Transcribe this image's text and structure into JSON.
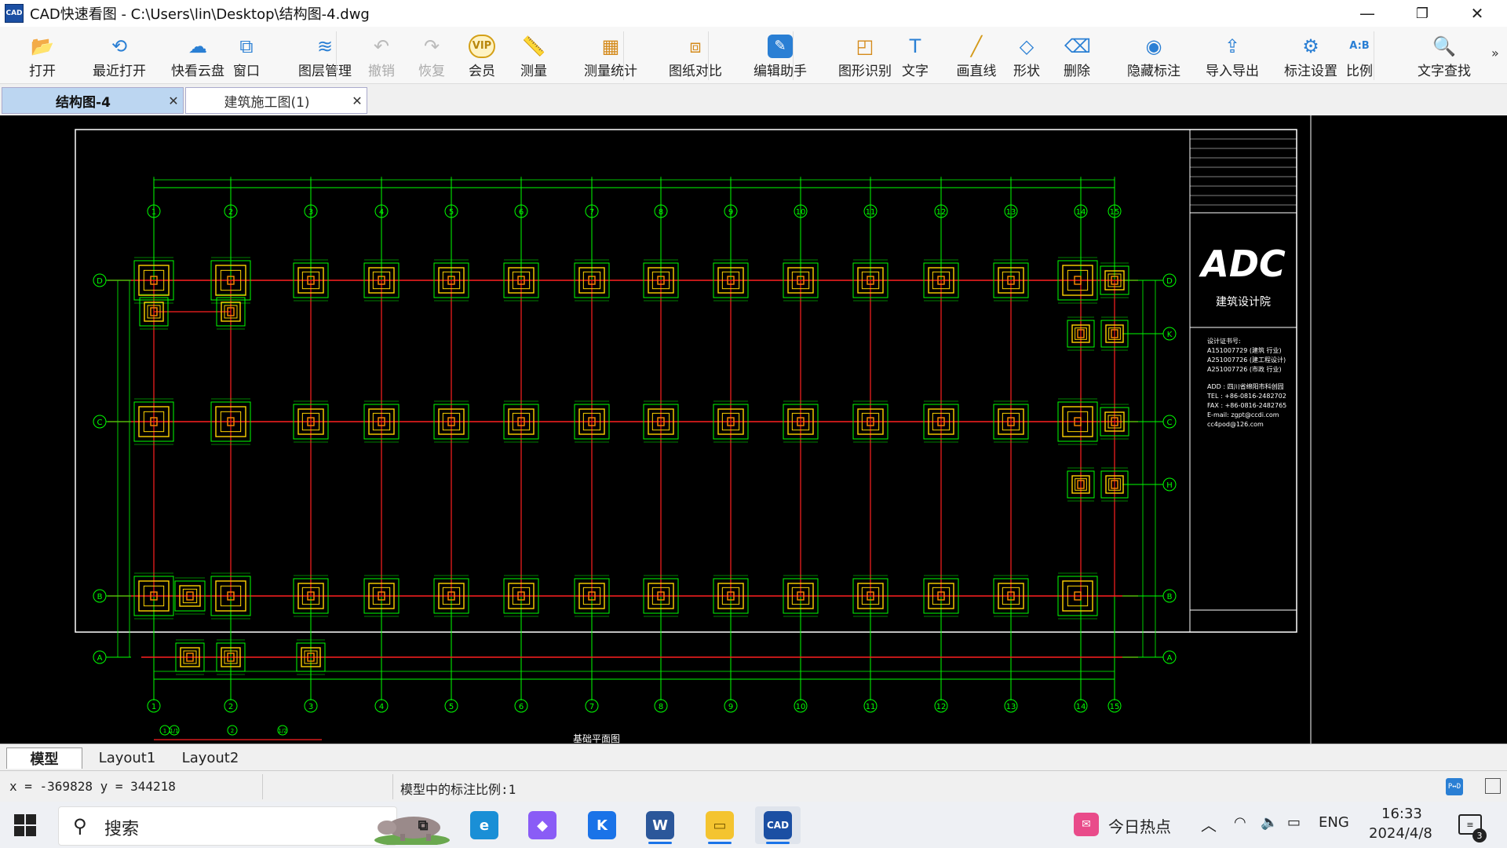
{
  "window": {
    "app_icon_text": "CAD",
    "title": "CAD快速看图 - C:\\Users\\lin\\Desktop\\结构图-4.dwg",
    "minimize": "—",
    "restore": "❐",
    "close": "✕"
  },
  "toolbar": [
    {
      "label": "打开",
      "icon": "folder-open-icon",
      "glyph": "📂",
      "enabled": true
    },
    {
      "label": "最近打开",
      "icon": "history-icon",
      "glyph": "⟲",
      "enabled": true
    },
    {
      "label": "快看云盘",
      "icon": "cloud-icon",
      "glyph": "☁",
      "enabled": true
    },
    {
      "label": "窗口",
      "icon": "window-icon",
      "glyph": "⧉",
      "enabled": true
    },
    {
      "label": "图层管理",
      "icon": "layers-icon",
      "glyph": "≋",
      "enabled": true
    },
    {
      "label": "撤销",
      "icon": "undo-icon",
      "glyph": "↶",
      "enabled": false
    },
    {
      "label": "恢复",
      "icon": "redo-icon",
      "glyph": "↷",
      "enabled": false
    },
    {
      "label": "会员",
      "icon": "vip-icon",
      "glyph": "VIP",
      "enabled": true
    },
    {
      "label": "测量",
      "icon": "ruler-icon",
      "glyph": "📏",
      "enabled": true
    },
    {
      "label": "测量统计",
      "icon": "measure-stats-icon",
      "glyph": "▦",
      "enabled": true
    },
    {
      "label": "图纸对比",
      "icon": "compare-icon",
      "glyph": "⧈",
      "enabled": true
    },
    {
      "label": "编辑助手",
      "icon": "edit-assistant-icon",
      "glyph": "✎",
      "enabled": true
    },
    {
      "label": "图形识别",
      "icon": "shape-recognize-icon",
      "glyph": "◰",
      "enabled": true
    },
    {
      "label": "文字",
      "icon": "text-icon",
      "glyph": "T",
      "enabled": true
    },
    {
      "label": "画直线",
      "icon": "line-icon",
      "glyph": "╱",
      "enabled": true
    },
    {
      "label": "形状",
      "icon": "shapes-icon",
      "glyph": "◇",
      "enabled": true
    },
    {
      "label": "删除",
      "icon": "eraser-icon",
      "glyph": "⌫",
      "enabled": true
    },
    {
      "label": "隐藏标注",
      "icon": "hide-eye-icon",
      "glyph": "◉",
      "enabled": true
    },
    {
      "label": "导入导出",
      "icon": "import-export-icon",
      "glyph": "⇪",
      "enabled": true
    },
    {
      "label": "标注设置",
      "icon": "annotation-settings-icon",
      "glyph": "⚙",
      "enabled": true
    },
    {
      "label": "比例",
      "icon": "scale-icon",
      "glyph": "A:B",
      "enabled": true
    },
    {
      "label": "文字查找",
      "icon": "text-search-icon",
      "glyph": "🔍",
      "enabled": true
    }
  ],
  "overflow": "»",
  "file_tabs": [
    {
      "label": "结构图-4",
      "active": true,
      "close": "✕"
    },
    {
      "label": "建筑施工图(1)",
      "active": false,
      "close": "✕"
    }
  ],
  "drawing": {
    "grid_columns": [
      "1",
      "2",
      "3",
      "4",
      "5",
      "6",
      "7",
      "8",
      "9",
      "10",
      "11",
      "12",
      "13",
      "14",
      "15"
    ],
    "grid_rows_left": [
      "D",
      "C",
      "B",
      "A"
    ],
    "grid_rows_right": [
      "D",
      "K",
      "C",
      "H",
      "B",
      "A"
    ],
    "bottom_extra_axes": [
      "1",
      "1/1",
      "2",
      "1/2"
    ],
    "title_block_logo": "ADC",
    "title_block_company": "建筑设计院",
    "title_block_lines": [
      "设计证书号:",
      "A151007729 (建筑 行业)",
      "A251007726 (建工程设计)",
      "A251007726 (市政 行业)",
      "ADD : 四川省绵阳市科创园",
      "TEL : +86-0816-2482702",
      "FAX : +86-0816-2482765",
      "E-mail: zgpt@ccdi.com",
      "cc4pod@126.com"
    ],
    "bottom_caption": "基础平面图",
    "colors": {
      "grid": "#00ff00",
      "beam": "#ff2020",
      "footing": "#ffd400",
      "frame": "#ffffff",
      "column": "#ff8c00"
    }
  },
  "layout_tabs": [
    "模型",
    "Layout1",
    "Layout2"
  ],
  "status": {
    "coords": "x = -369828  y = 344218",
    "scale": "模型中的标注比例:1",
    "pd_button": "P↔D"
  },
  "taskbar": {
    "search_placeholder": "搜索",
    "news": "今日热点",
    "lang": "ENG",
    "time": "16:33",
    "date": "2024/4/8",
    "notifications": "3",
    "apps": [
      {
        "name": "task-view",
        "glyph": "⧉",
        "bg": "transparent",
        "fg": "#222"
      },
      {
        "name": "edge",
        "glyph": "e",
        "bg": "#1a8fd6",
        "fg": "#fff"
      },
      {
        "name": "copilot",
        "glyph": "◆",
        "bg": "#8a5cf6",
        "fg": "#fff"
      },
      {
        "name": "k-app",
        "glyph": "K",
        "bg": "#1a73e8",
        "fg": "#fff"
      },
      {
        "name": "word",
        "glyph": "W",
        "bg": "#2b579a",
        "fg": "#fff"
      },
      {
        "name": "file-explorer",
        "glyph": "▭",
        "bg": "#f4c430",
        "fg": "#7a5a00"
      },
      {
        "name": "cad-viewer",
        "glyph": "CAD",
        "bg": "#1b4fa3",
        "fg": "#fff"
      }
    ]
  }
}
